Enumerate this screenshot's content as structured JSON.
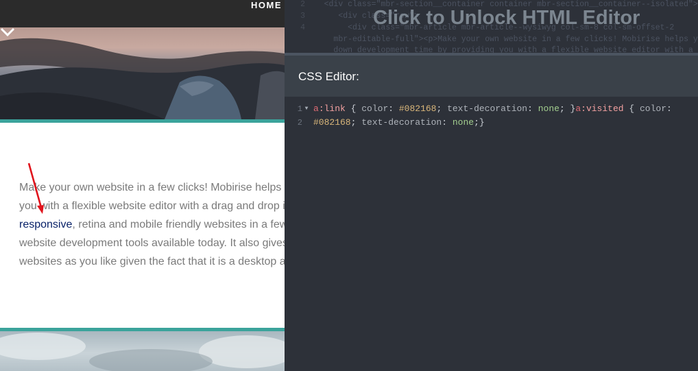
{
  "preview": {
    "nav": {
      "home_label": "HOME"
    },
    "article": {
      "lines": [
        "Make your own website in a few clicks! Mobirise helps you cut down development time by providing",
        "you with a flexible website editor with a drag and drop interface. MobiRise Website Builder creates",
        ", retina and mobile friendly websites in a few clicks. Mobirise is one of the easiest",
        "website development tools available today. It also gives you the freedom to develop as many",
        "websites as you like given the fact that it is a desktop app."
      ],
      "link_text": "responsive"
    },
    "colors": {
      "teal_divider": "#3ba39b",
      "link": "#082168",
      "annotation_arrow": "#e0141c"
    }
  },
  "html_editor": {
    "unlock_label": "Click to Unlock HTML Editor",
    "line_numbers": [
      "2",
      "3",
      "4",
      "",
      ""
    ],
    "code_lines": [
      "<div class=\"mbr-section__container container mbr-section__container--isolated\">",
      "    <div class=\"row\">",
      "        <div class=\"mbr-article mbr-article--wysiwyg col-sm-8 col-sm-offset-2",
      "mbr-editable-full\"><p>Make your own website in a few clicks! Mobirise helps you cut",
      "down development time by providing you with a flexible website editor with a drag"
    ]
  },
  "css_editor": {
    "title": "CSS Editor:",
    "lines": [
      {
        "number": "1",
        "fold": true,
        "tokens": [
          {
            "text": "a",
            "type": "sel"
          },
          {
            "text": ":link",
            "type": "pseudo"
          },
          {
            "text": " { ",
            "type": "punct"
          },
          {
            "text": "color",
            "type": "prop"
          },
          {
            "text": ": ",
            "type": "punct"
          },
          {
            "text": "#082168",
            "type": "val"
          },
          {
            "text": "; ",
            "type": "punct"
          },
          {
            "text": "text-decoration",
            "type": "prop"
          },
          {
            "text": ": ",
            "type": "punct"
          },
          {
            "text": "none",
            "type": "kw"
          },
          {
            "text": "; }",
            "type": "punct"
          },
          {
            "text": "a",
            "type": "sel"
          },
          {
            "text": ":visited",
            "type": "pseudo"
          },
          {
            "text": " { ",
            "type": "punct"
          },
          {
            "text": "color",
            "type": "prop"
          },
          {
            "text": ":",
            "type": "punct"
          }
        ]
      },
      {
        "number": "2",
        "fold": false,
        "tokens": [
          {
            "text": "#082168",
            "type": "val"
          },
          {
            "text": "; ",
            "type": "punct"
          },
          {
            "text": "text-decoration",
            "type": "prop"
          },
          {
            "text": ": ",
            "type": "punct"
          },
          {
            "text": "none",
            "type": "kw"
          },
          {
            "text": ";}",
            "type": "punct"
          }
        ]
      }
    ]
  },
  "icons": {
    "hero_scroll": "chevron-down-icon",
    "annotation": "red-arrow-icon",
    "fold": "fold-triangle-icon"
  }
}
